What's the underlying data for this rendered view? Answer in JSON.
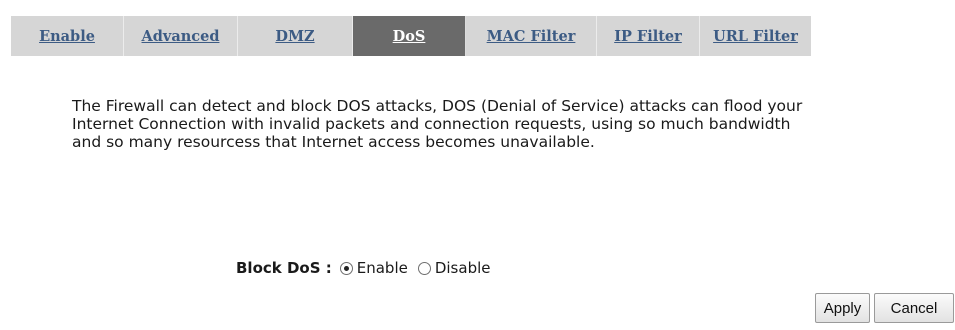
{
  "tabs": [
    {
      "label": "Enable"
    },
    {
      "label": "Advanced"
    },
    {
      "label": "DMZ"
    },
    {
      "label": "DoS"
    },
    {
      "label": "MAC Filter"
    },
    {
      "label": "IP Filter"
    },
    {
      "label": "URL Filter"
    }
  ],
  "active_tab": "DoS",
  "description": {
    "line1": "The Firewall can detect and block DOS attacks, DOS (Denial of Service) attacks can flood your",
    "line2": "Internet Connection with invalid packets and connection requests, using so much bandwidth",
    "line3": "and so many resourcess that Internet access becomes unavailable."
  },
  "block_dos": {
    "label": "Block DoS :",
    "options": [
      "Enable",
      "Disable"
    ],
    "selected": "Enable"
  },
  "buttons": {
    "apply": "Apply",
    "cancel": "Cancel"
  },
  "colors": {
    "tab_text": "#3c5b84",
    "tab_bar_bg": "#d6d6d6",
    "active_tab_bg": "#6a6a6a"
  }
}
